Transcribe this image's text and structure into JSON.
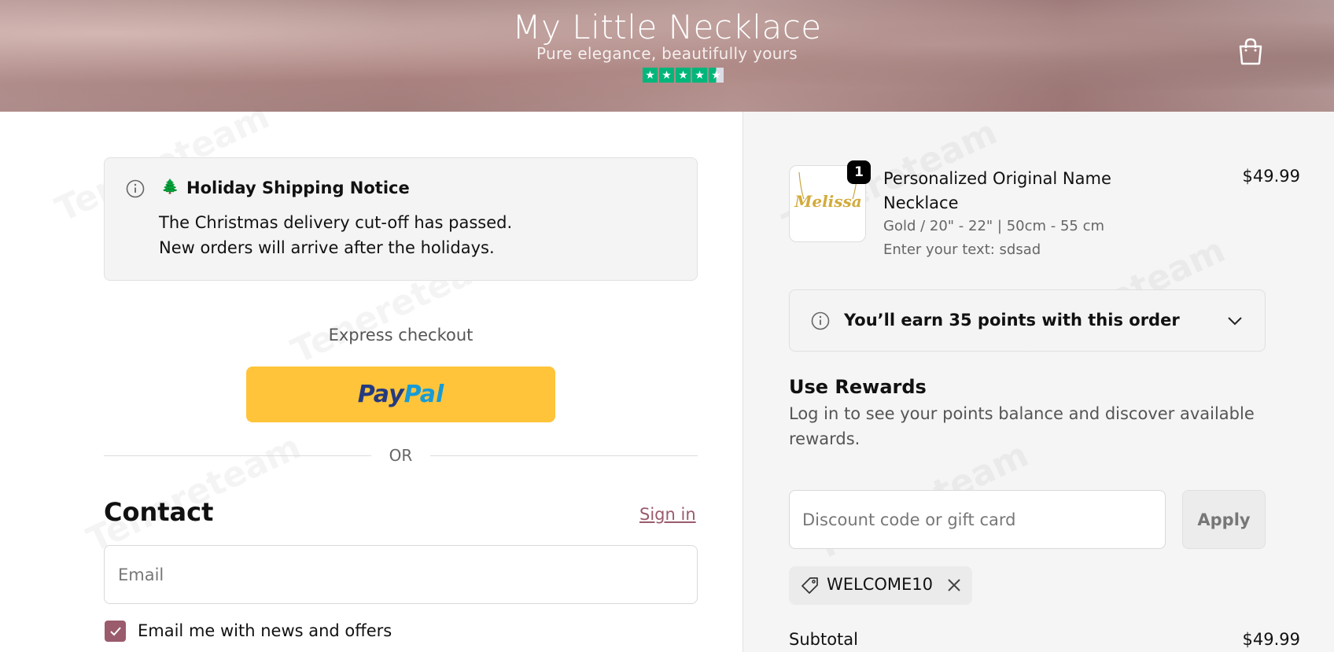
{
  "header": {
    "brand_title": "My Little Necklace",
    "tagline": "Pure elegance, beautifully yours",
    "rating_stars": 4.5
  },
  "notice": {
    "icon": "info-icon",
    "emoji": "🌲",
    "title": "Holiday Shipping Notice",
    "line1": "The Christmas delivery cut-off has passed.",
    "line2": "New orders will arrive after the holidays."
  },
  "express": {
    "label": "Express checkout",
    "paypal_part1": "Pay",
    "paypal_part2": "Pal",
    "or_label": "OR"
  },
  "contact": {
    "heading": "Contact",
    "signin_label": "Sign in",
    "email_placeholder": "Email",
    "newsletter_label": "Email me with news and offers",
    "newsletter_checked": true
  },
  "order": {
    "quantity": "1",
    "product_name": "Personalized Original Name Necklace",
    "product_price": "$49.99",
    "variant": "Gold / 20\" - 22\" | 50cm - 55 cm",
    "custom_text": "Enter your text: sdsad",
    "thumb_text": "Melissa"
  },
  "points": {
    "label": "You’ll earn 35 points with this order"
  },
  "rewards": {
    "heading": "Use Rewards",
    "description": "Log in to see your points balance and discover available rewards."
  },
  "discount": {
    "placeholder": "Discount code or gift card",
    "apply_label": "Apply",
    "applied_code": "WELCOME10"
  },
  "summary": {
    "subtotal_label": "Subtotal",
    "subtotal_value": "$49.99"
  },
  "colors": {
    "accent": "#9a5b6c",
    "paypal_yellow": "#ffc439",
    "trustpilot_green": "#00b67a"
  }
}
